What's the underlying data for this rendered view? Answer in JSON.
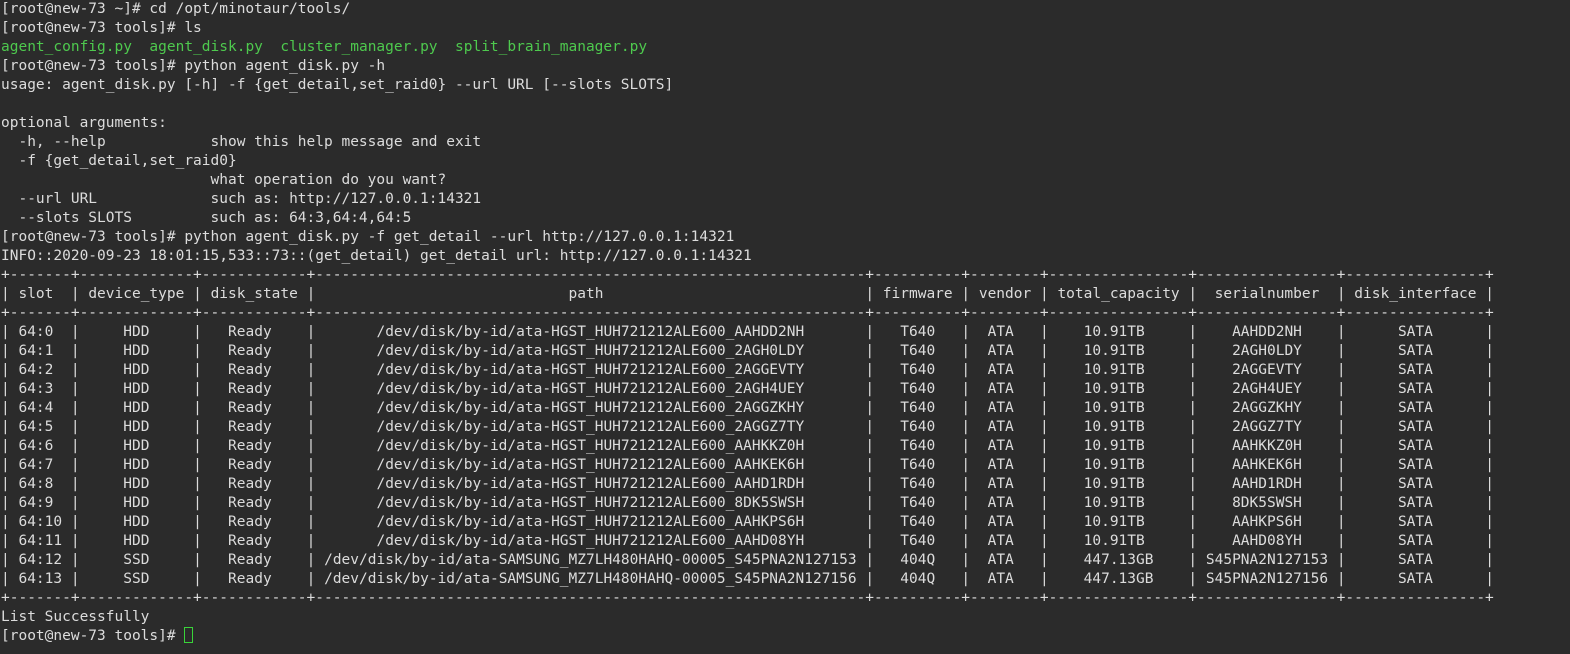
{
  "session": {
    "prompt_home": "[root@new-73 ~]# ",
    "prompt_tools": "[root@new-73 tools]# "
  },
  "lines": [
    {
      "kind": "cmd",
      "prompt": "[root@new-73 ~]# ",
      "text": "cd /opt/minotaur/tools/"
    },
    {
      "kind": "cmd",
      "prompt": "[root@new-73 tools]# ",
      "text": "ls"
    },
    {
      "kind": "ls",
      "files": [
        "agent_config.py",
        "agent_disk.py",
        "cluster_manager.py",
        "split_brain_manager.py"
      ]
    },
    {
      "kind": "cmd",
      "prompt": "[root@new-73 tools]# ",
      "text": "python agent_disk.py -h"
    },
    {
      "kind": "out",
      "text": "usage: agent_disk.py [-h] -f {get_detail,set_raid0} --url URL [--slots SLOTS]"
    },
    {
      "kind": "out",
      "text": ""
    },
    {
      "kind": "out",
      "text": "optional arguments:"
    },
    {
      "kind": "out",
      "text": "  -h, --help            show this help message and exit"
    },
    {
      "kind": "out",
      "text": "  -f {get_detail,set_raid0}"
    },
    {
      "kind": "out",
      "text": "                        what operation do you want?"
    },
    {
      "kind": "out",
      "text": "  --url URL             such as: http://127.0.0.1:14321"
    },
    {
      "kind": "out",
      "text": "  --slots SLOTS         such as: 64:3,64:4,64:5"
    },
    {
      "kind": "cmd",
      "prompt": "[root@new-73 tools]# ",
      "text": "python agent_disk.py -f get_detail --url http://127.0.0.1:14321"
    },
    {
      "kind": "out",
      "text": "INFO::2020-09-23 18:01:15,533::73::(get_detail) get_detail url: http://127.0.0.1:14321"
    }
  ],
  "table": {
    "columns": [
      "slot",
      "device_type",
      "disk_state",
      "path",
      "firmware",
      "vendor",
      "total_capacity",
      "serialnumber",
      "disk_interface"
    ],
    "rows": [
      [
        "64:0",
        "HDD",
        "Ready",
        "/dev/disk/by-id/ata-HGST_HUH721212ALE600_AAHDD2NH",
        "T640",
        "ATA",
        "10.91TB",
        "AAHDD2NH",
        "SATA"
      ],
      [
        "64:1",
        "HDD",
        "Ready",
        "/dev/disk/by-id/ata-HGST_HUH721212ALE600_2AGH0LDY",
        "T640",
        "ATA",
        "10.91TB",
        "2AGH0LDY",
        "SATA"
      ],
      [
        "64:2",
        "HDD",
        "Ready",
        "/dev/disk/by-id/ata-HGST_HUH721212ALE600_2AGGEVTY",
        "T640",
        "ATA",
        "10.91TB",
        "2AGGEVTY",
        "SATA"
      ],
      [
        "64:3",
        "HDD",
        "Ready",
        "/dev/disk/by-id/ata-HGST_HUH721212ALE600_2AGH4UEY",
        "T640",
        "ATA",
        "10.91TB",
        "2AGH4UEY",
        "SATA"
      ],
      [
        "64:4",
        "HDD",
        "Ready",
        "/dev/disk/by-id/ata-HGST_HUH721212ALE600_2AGGZKHY",
        "T640",
        "ATA",
        "10.91TB",
        "2AGGZKHY",
        "SATA"
      ],
      [
        "64:5",
        "HDD",
        "Ready",
        "/dev/disk/by-id/ata-HGST_HUH721212ALE600_2AGGZ7TY",
        "T640",
        "ATA",
        "10.91TB",
        "2AGGZ7TY",
        "SATA"
      ],
      [
        "64:6",
        "HDD",
        "Ready",
        "/dev/disk/by-id/ata-HGST_HUH721212ALE600_AAHKKZ0H",
        "T640",
        "ATA",
        "10.91TB",
        "AAHKKZ0H",
        "SATA"
      ],
      [
        "64:7",
        "HDD",
        "Ready",
        "/dev/disk/by-id/ata-HGST_HUH721212ALE600_AAHKEK6H",
        "T640",
        "ATA",
        "10.91TB",
        "AAHKEK6H",
        "SATA"
      ],
      [
        "64:8",
        "HDD",
        "Ready",
        "/dev/disk/by-id/ata-HGST_HUH721212ALE600_AAHD1RDH",
        "T640",
        "ATA",
        "10.91TB",
        "AAHD1RDH",
        "SATA"
      ],
      [
        "64:9",
        "HDD",
        "Ready",
        "/dev/disk/by-id/ata-HGST_HUH721212ALE600_8DK5SWSH",
        "T640",
        "ATA",
        "10.91TB",
        "8DK5SWSH",
        "SATA"
      ],
      [
        "64:10",
        "HDD",
        "Ready",
        "/dev/disk/by-id/ata-HGST_HUH721212ALE600_AAHKPS6H",
        "T640",
        "ATA",
        "10.91TB",
        "AAHKPS6H",
        "SATA"
      ],
      [
        "64:11",
        "HDD",
        "Ready",
        "/dev/disk/by-id/ata-HGST_HUH721212ALE600_AAHD08YH",
        "T640",
        "ATA",
        "10.91TB",
        "AAHD08YH",
        "SATA"
      ],
      [
        "64:12",
        "SSD",
        "Ready",
        "/dev/disk/by-id/ata-SAMSUNG_MZ7LH480HAHQ-00005_S45PNA2N127153",
        "404Q",
        "ATA",
        "447.13GB",
        "S45PNA2N127153",
        "SATA"
      ],
      [
        "64:13",
        "SSD",
        "Ready",
        "/dev/disk/by-id/ata-SAMSUNG_MZ7LH480HAHQ-00005_S45PNA2N127156",
        "404Q",
        "ATA",
        "447.13GB",
        "S45PNA2N127156",
        "SATA"
      ]
    ]
  },
  "footer": {
    "message": "List Successfully",
    "final_prompt": "[root@new-73 tools]# "
  },
  "colors": {
    "background": "#2b2b2b",
    "text": "#dcdcdc",
    "file_green": "#4ec94e",
    "cursor": "#39d439"
  }
}
